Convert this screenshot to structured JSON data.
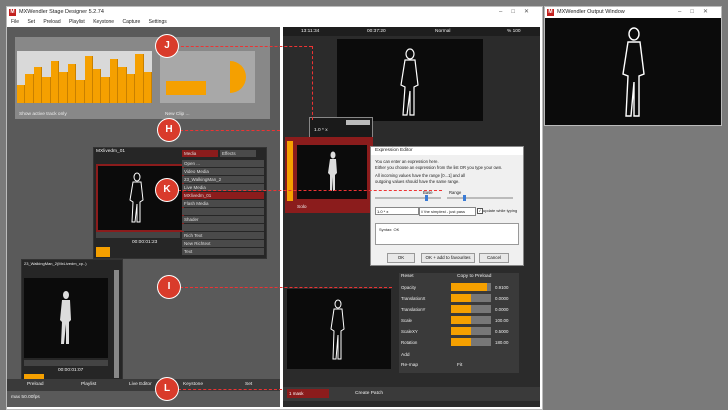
{
  "main_window": {
    "title": "MXWendler Stage Designer 5.2.74",
    "menu": [
      "File",
      "Set",
      "Preload",
      "Playlist",
      "Keystone",
      "Capture",
      "Settings"
    ]
  },
  "output_window": {
    "title": "MXWendler Output Window"
  },
  "transport": {
    "time_left": "13:11:34",
    "time_mid": "00:37:20",
    "mode": "Normal",
    "zoom": "% 100"
  },
  "clip_strip": {
    "show_active_label": "Show active track only",
    "new_clip_label": "New Clip ..."
  },
  "clip_panel": {
    "title": "MXlivedm_01",
    "time": "00:00:01:23",
    "tabs": [
      "Media",
      "Effects"
    ],
    "rows": [
      {
        "label": "Open ...",
        "active": false
      },
      {
        "label": "Video Media",
        "active": false
      },
      {
        "label": "23_WalkingMan_2",
        "active": false
      },
      {
        "label": "Live Media",
        "active": false
      },
      {
        "label": "MXlivedm_01",
        "active": true
      },
      {
        "label": "Flash Media",
        "active": false
      },
      {
        "label": "",
        "active": false
      },
      {
        "label": "Shader",
        "active": false
      },
      {
        "label": "",
        "active": false
      },
      {
        "label": "Rich Text",
        "active": false
      },
      {
        "label": "New Richtext",
        "active": false
      },
      {
        "label": "Text",
        "active": false
      }
    ]
  },
  "clip_panel2": {
    "title": "23_WalkingMan_2(MxLivedm_cp..)",
    "time": "00:00:01:07"
  },
  "status_left": "max 50.00fps",
  "bottom_tabs": [
    "Preload",
    "Playlist",
    "Live Editor",
    "Keystone",
    "Set"
  ],
  "expr_popup": {
    "value": "1.0 * x"
  },
  "mid_panel": {
    "label": "Solo"
  },
  "expression_editor": {
    "title": "Expression Editor",
    "desc1": "You can enter an expression here.",
    "desc2": "Either you choose an expression from the list OR you type your own.",
    "desc3": "All incoming values have the range [0...1] and all",
    "desc4": "outgoing values should have the same range.",
    "base_label": "Base",
    "range_label": "Range",
    "expression": "1.0 * x",
    "preset": "// the simplest - just pass",
    "update_label": "update while typing",
    "syntax": "Syntax: OK",
    "ok": "OK",
    "ok_fav": "OK + add to favourites",
    "cancel": "Cancel"
  },
  "layer_params": {
    "reset": "Reset",
    "copy_preload": "Copy to Preload",
    "rows": [
      {
        "label": "Opacity",
        "value": "0.9100",
        "fill": 0.91
      },
      {
        "label": "TranslationX",
        "value": "0.0000",
        "fill": 0.5
      },
      {
        "label": "TranslationY",
        "value": "0.0000",
        "fill": 0.5
      },
      {
        "label": "Scale",
        "value": "100.00",
        "fill": 0.5
      },
      {
        "label": "ScaleXY",
        "value": "0.5000",
        "fill": 0.5
      },
      {
        "label": "Rotation",
        "value": "180.00",
        "fill": 0.5
      }
    ],
    "add": "Add",
    "remap": "Re-map",
    "fit": "Fit"
  },
  "bottom_bar": {
    "mask": "1 mask",
    "create_patch": "Create Patch"
  },
  "markers": [
    "J",
    "H",
    "K",
    "I",
    "L"
  ],
  "colors": {
    "accent": "#f5a000",
    "marker": "#d93b2b",
    "selection": "#8b1c1c"
  }
}
